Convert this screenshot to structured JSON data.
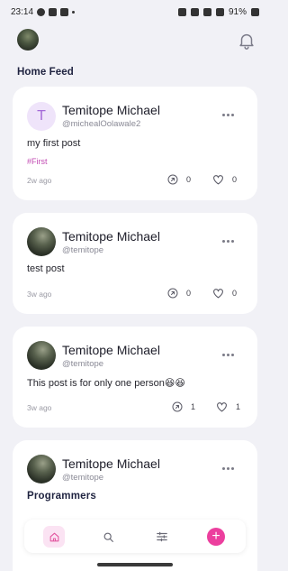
{
  "status": {
    "time": "23:14",
    "battery": "91%"
  },
  "header": {
    "feed_title": "Home Feed"
  },
  "posts": [
    {
      "initial": "T",
      "name": "Temitope Michael",
      "handle": "@michealOolawale2",
      "body": "my first post",
      "tag": "#First",
      "time": "2w ago",
      "shares": "0",
      "likes": "0"
    },
    {
      "name": "Temitope Michael",
      "handle": "@temitope",
      "body": "test post",
      "time": "3w ago",
      "shares": "0",
      "likes": "0"
    },
    {
      "name": "Temitope Michael",
      "handle": "@temitope",
      "body": "This post is for only one person😆😆",
      "time": "3w ago",
      "shares": "1",
      "likes": "1"
    },
    {
      "name": "Temitope Michael",
      "handle": "@temitope",
      "title": "Programmers"
    }
  ],
  "icons": {
    "bell": "bell-icon",
    "more": "more-horizontal-icon",
    "share": "share-arrow-icon",
    "like": "heart-icon",
    "home": "home-icon",
    "search": "search-icon",
    "filter": "sliders-icon",
    "add": "plus-icon"
  },
  "colors": {
    "accent": "#ec3f9e",
    "tag": "#c24bb3",
    "background": "#f1f1f6"
  }
}
